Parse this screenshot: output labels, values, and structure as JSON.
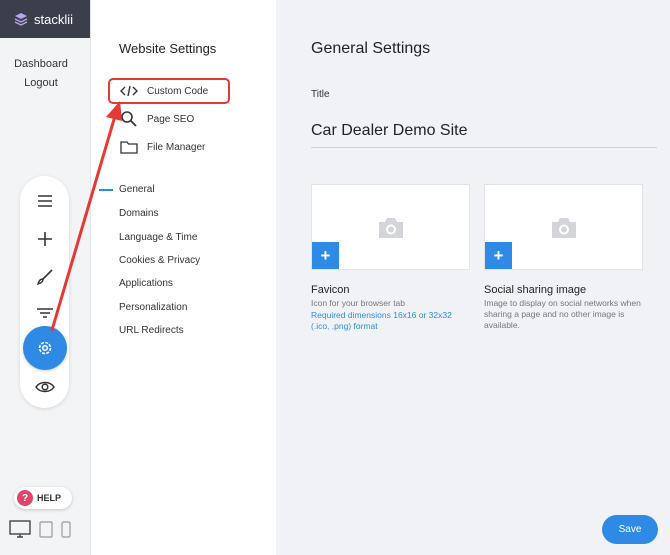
{
  "app": {
    "brand": "stacklii"
  },
  "rail": {
    "links": [
      "Dashboard",
      "Logout"
    ],
    "tools": [
      "menu-icon",
      "plus-icon",
      "brush-icon",
      "filter-icon",
      "gear-icon",
      "eye-icon"
    ],
    "active_tool": "gear-icon",
    "help_label": "HELP",
    "devices": [
      "desktop-icon",
      "tablet-icon",
      "phone-icon"
    ]
  },
  "settings_nav": {
    "title": "Website Settings",
    "tools": [
      {
        "label": "Custom Code",
        "icon": "code-icon"
      },
      {
        "label": "Page SEO",
        "icon": "search-icon"
      },
      {
        "label": "File Manager",
        "icon": "folder-icon"
      }
    ],
    "items": [
      "General",
      "Domains",
      "Language & Time",
      "Cookies & Privacy",
      "Applications",
      "Personalization",
      "URL Redirects"
    ],
    "active_item": "General"
  },
  "main": {
    "page_title": "General Settings",
    "title_label": "Title",
    "title_value": "Car Dealer Demo Site",
    "favicon": {
      "title": "Favicon",
      "description": "Icon for your browser tab",
      "requirement": "Required dimensions 16x16 or 32x32 (.ico, .png) format"
    },
    "social": {
      "title": "Social sharing image",
      "description": "Image to display on social networks when sharing a page and no other image is available."
    },
    "save_label": "Save"
  },
  "colors": {
    "accent": "#2f8ae6",
    "highlight": "#e53935",
    "brand_bar": "#3a3f4b"
  }
}
